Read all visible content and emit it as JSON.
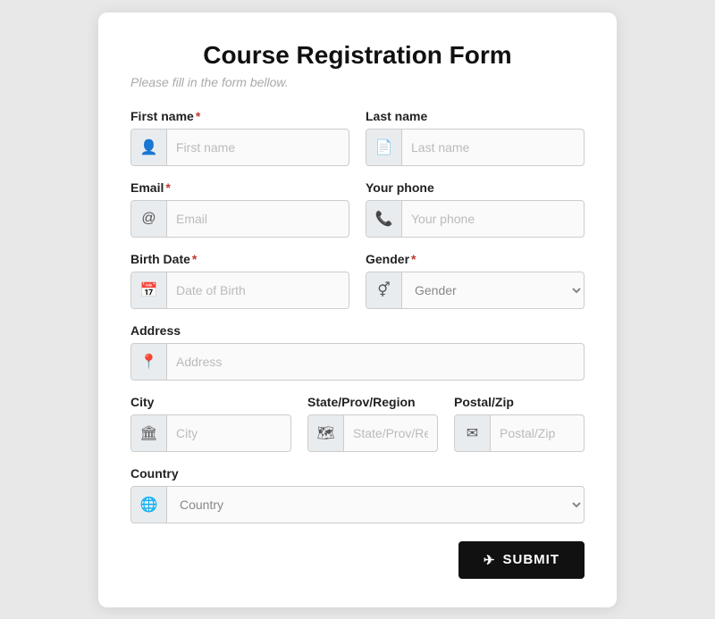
{
  "form": {
    "title": "Course Registration Form",
    "subtitle": "Please fill in the form bellow.",
    "fields": {
      "first_name_label": "First name",
      "first_name_placeholder": "First name",
      "last_name_label": "Last name",
      "last_name_placeholder": "Last name",
      "email_label": "Email",
      "email_placeholder": "Email",
      "phone_label": "Your phone",
      "phone_placeholder": "Your phone",
      "birth_date_label": "Birth Date",
      "birth_date_placeholder": "Date of Birth",
      "gender_label": "Gender",
      "gender_placeholder": "Gender",
      "address_label": "Address",
      "address_placeholder": "Address",
      "city_label": "City",
      "city_placeholder": "City",
      "state_label": "State/Prov/Region",
      "state_placeholder": "State/Prov/Reg...",
      "zip_label": "Postal/Zip",
      "zip_placeholder": "Postal/Zip",
      "country_label": "Country",
      "country_placeholder": "Country"
    },
    "submit_label": "SUBMIT",
    "required_marker": "*"
  }
}
